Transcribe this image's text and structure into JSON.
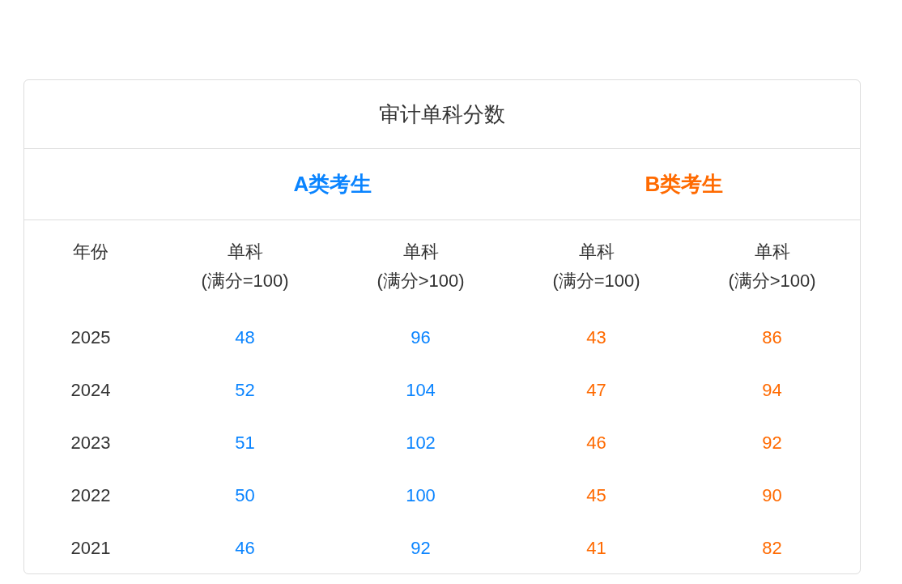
{
  "title": "审计单科分数",
  "year_heading": "年份",
  "groups": [
    {
      "label": "A类考生",
      "color": "#0a84ff",
      "columns": [
        {
          "label": "单科",
          "sublabel": "(满分=100)"
        },
        {
          "label": "单科",
          "sublabel": "(满分>100)"
        }
      ]
    },
    {
      "label": "B类考生",
      "color": "#ff6a00",
      "columns": [
        {
          "label": "单科",
          "sublabel": "(满分=100)"
        },
        {
          "label": "单科",
          "sublabel": "(满分>100)"
        }
      ]
    }
  ],
  "rows": [
    {
      "year": "2025",
      "values": [
        "48",
        "96",
        "43",
        "86"
      ]
    },
    {
      "year": "2024",
      "values": [
        "52",
        "104",
        "47",
        "94"
      ]
    },
    {
      "year": "2023",
      "values": [
        "51",
        "102",
        "46",
        "92"
      ]
    },
    {
      "year": "2022",
      "values": [
        "50",
        "100",
        "45",
        "90"
      ]
    },
    {
      "year": "2021",
      "values": [
        "46",
        "92",
        "41",
        "82"
      ]
    }
  ]
}
